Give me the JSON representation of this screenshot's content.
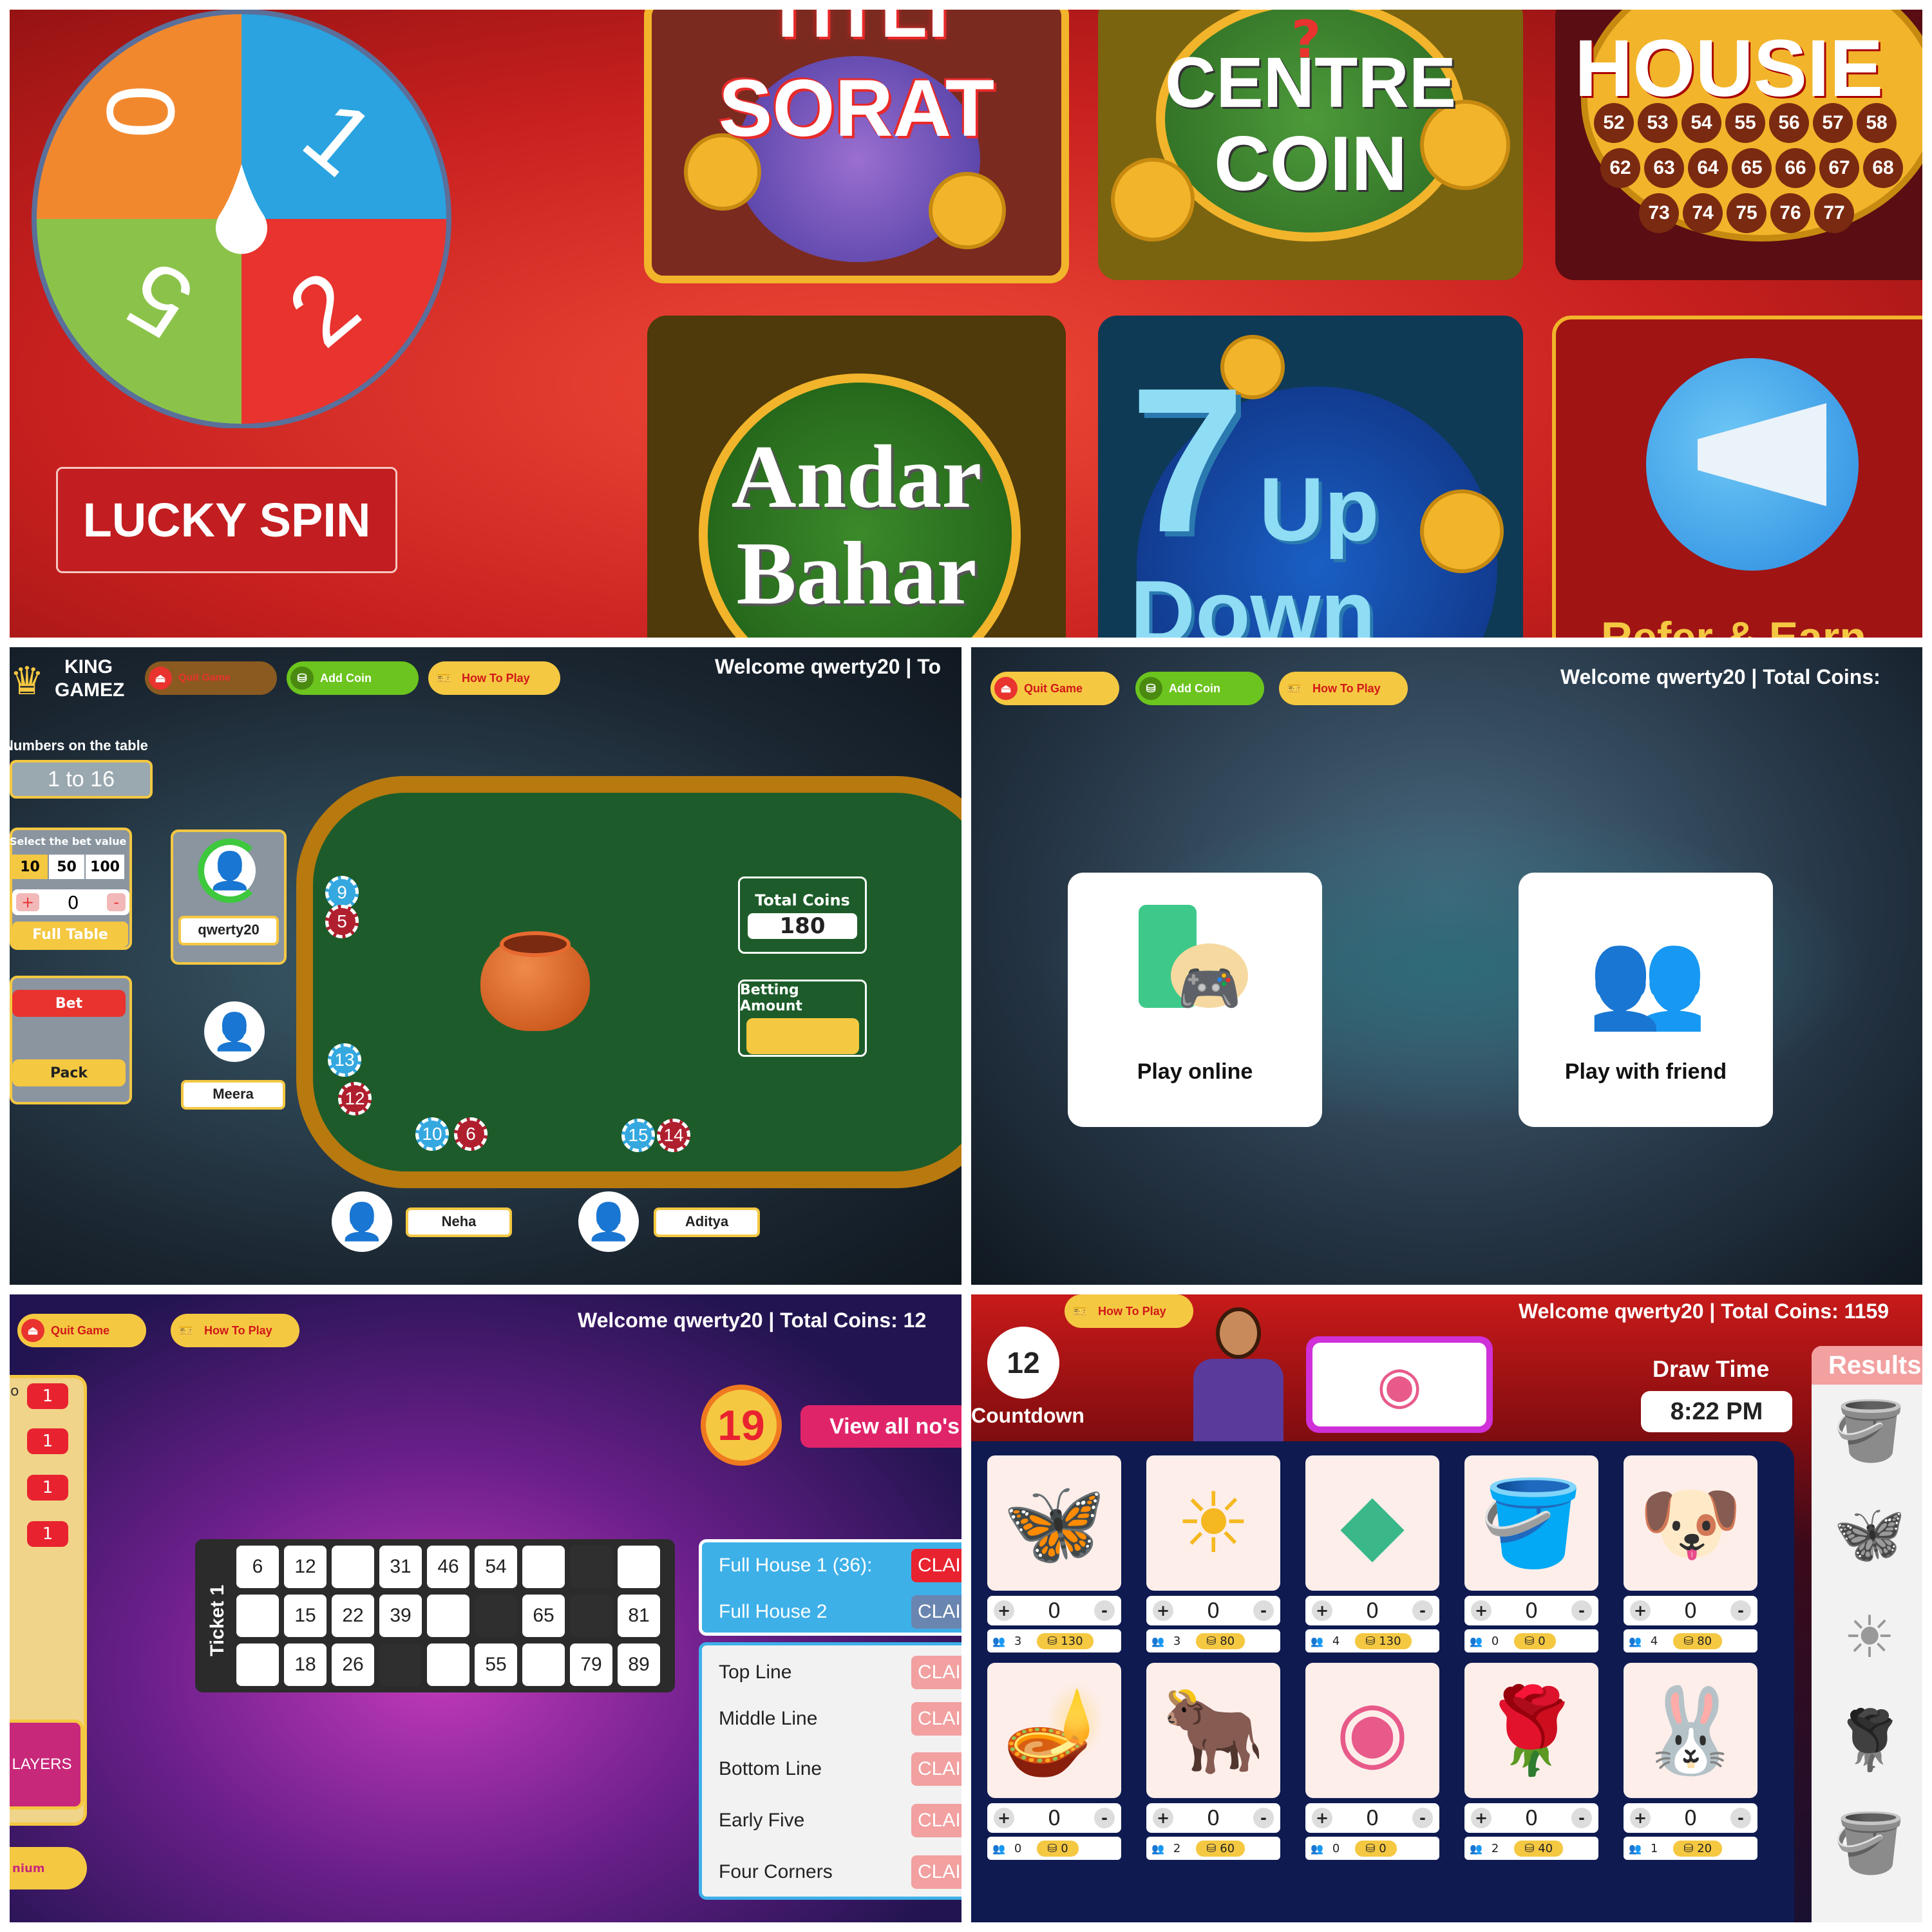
{
  "top_banner": {
    "wheel_numbers": [
      "0",
      "1",
      "5",
      "2"
    ],
    "lucky_spin_label": "LUCKY SPIN",
    "tiles": [
      {
        "title_line1": "TITLI",
        "title_line2": "SORAT"
      },
      {
        "title_line1": "CENTRE",
        "title_line2": "COIN",
        "decor": "?"
      },
      {
        "title_line1": "HOUSIE",
        "numbers_row1": [
          "52",
          "53",
          "54",
          "55",
          "56",
          "57",
          "58"
        ],
        "numbers_row2": [
          "62",
          "63",
          "64",
          "65",
          "66",
          "67",
          "68"
        ],
        "numbers_row3": [
          "73",
          "74",
          "75",
          "76",
          "77"
        ]
      },
      {
        "title_line1": "Andar",
        "title_line2": "Bahar"
      },
      {
        "title_line1": "7",
        "title_line2": "Up",
        "title_line3": "Down"
      },
      {
        "title_line1": "Refer & Earn"
      }
    ]
  },
  "table_game": {
    "logo_line1": "KING",
    "logo_line2": "GAMEZ",
    "quit_label": "Quit Game",
    "add_coin_label": "Add Coin",
    "how_to_play_label": "How To Play",
    "welcome": "Welcome qwerty20 | To",
    "numbers_label": "Numbers on the table",
    "numbers_value": "1 to 16",
    "bet_select_label": "Select the bet value",
    "bet_values": [
      "10",
      "50",
      "100"
    ],
    "stepper_plus": "+",
    "stepper_value": "0",
    "stepper_minus": "-",
    "full_table_label": "Full Table",
    "bet_label": "Bet",
    "pack_label": "Pack",
    "players": [
      "qwerty20",
      "Meera",
      "Neha",
      "Aditya"
    ],
    "total_coins_label": "Total Coins",
    "total_coins_value": "180",
    "betting_amount_label": "Betting Amount",
    "chips": [
      "9",
      "5",
      "13",
      "12",
      "10",
      "6",
      "15",
      "14"
    ]
  },
  "mode_select": {
    "quit_label": "Quit Game",
    "add_coin_label": "Add Coin",
    "how_to_play_label": "How To Play",
    "welcome": "Welcome qwerty20 | Total Coins:",
    "play_online_label": "Play online",
    "play_friend_label": "Play with friend"
  },
  "housie_game": {
    "quit_label": "Quit Game",
    "how_to_play_label": "How To Play",
    "welcome": "Welcome qwerty20 | Total Coins: 12",
    "left_counts": [
      "1",
      "1",
      "1",
      "1"
    ],
    "left_char": "o",
    "players_label": "LAYERS",
    "premium_label": "nium",
    "current_number": "19",
    "view_all_label": "View all no's",
    "ticket_label": "Ticket 1",
    "ticket_rows": [
      [
        "6",
        "12",
        "",
        "31",
        "46",
        "54",
        "",
        "",
        ""
      ],
      [
        "",
        "15",
        "22",
        "39",
        "",
        "",
        "65",
        "",
        "81"
      ],
      [
        "",
        "18",
        "26",
        "",
        "",
        "55",
        "",
        "79",
        "89"
      ]
    ],
    "ticket_dark": [
      [
        false,
        true,
        false,
        true,
        false,
        true,
        false,
        true,
        false
      ],
      [
        false,
        true,
        false,
        true,
        false,
        true,
        false,
        true,
        false
      ],
      [
        false,
        true,
        false,
        true,
        false,
        true,
        false,
        true,
        false
      ]
    ],
    "full_house": [
      {
        "label": "Full House 1  (36):",
        "claim": "CLAIM"
      },
      {
        "label": "Full House 2",
        "claim": "CLAIM"
      }
    ],
    "claims": [
      {
        "label": "Top Line",
        "claim": "CLAIM"
      },
      {
        "label": "Middle Line",
        "claim": "CLAIM"
      },
      {
        "label": "Bottom Line",
        "claim": "CLAIM"
      },
      {
        "label": "Early Five",
        "claim": "CLAIM"
      },
      {
        "label": "Four Corners",
        "claim": "CLAIM"
      }
    ]
  },
  "sorat_game": {
    "how_to_play_label": "How To Play",
    "welcome": "Welcome qwerty20 | Total Coins: 1159",
    "countdown_value": "12",
    "countdown_label": "Countdown",
    "draw_time_label": "Draw Time",
    "draw_time_value": "8:22 PM",
    "results_label": "Results",
    "items": [
      {
        "name": "butterfly",
        "icon": "🦋",
        "value": "0",
        "players": "3",
        "coins": "130"
      },
      {
        "name": "sun",
        "icon": "☀",
        "value": "0",
        "players": "3",
        "coins": "80"
      },
      {
        "name": "kite",
        "icon": "◆",
        "value": "0",
        "players": "4",
        "coins": "130"
      },
      {
        "name": "bucket",
        "icon": "🪣",
        "value": "0",
        "players": "0",
        "coins": "0"
      },
      {
        "name": "dog",
        "icon": "🐶",
        "value": "0",
        "players": "4",
        "coins": "80"
      },
      {
        "name": "diya",
        "icon": "🪔",
        "value": "0",
        "players": "0",
        "coins": "0"
      },
      {
        "name": "bull",
        "icon": "🐂",
        "value": "0",
        "players": "2",
        "coins": "60"
      },
      {
        "name": "top",
        "icon": "◉",
        "value": "0",
        "players": "0",
        "coins": "0"
      },
      {
        "name": "rose",
        "icon": "🌹",
        "value": "0",
        "players": "2",
        "coins": "40"
      },
      {
        "name": "rabbit",
        "icon": "🐰",
        "value": "0",
        "players": "1",
        "coins": "20"
      }
    ],
    "result_icons": [
      "bucket",
      "butterfly",
      "sun",
      "rose",
      "bucket"
    ]
  }
}
